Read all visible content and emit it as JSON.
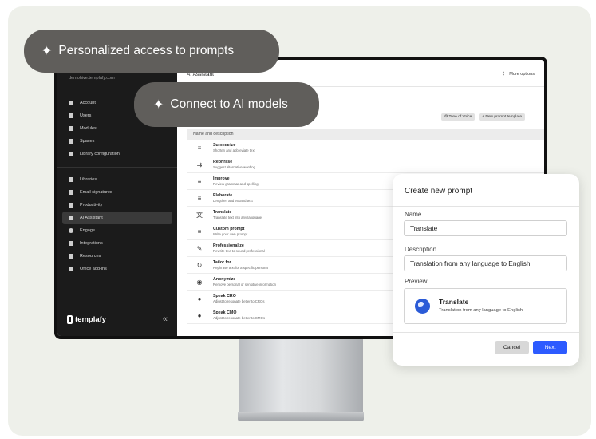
{
  "badges": {
    "personalized": "Personalized access to prompts",
    "connect": "Connect to AI models"
  },
  "sidebar": {
    "domain": "demohive.templafy.com",
    "group1": [
      {
        "label": "Account",
        "icon": "account-icon"
      },
      {
        "label": "Users",
        "icon": "users-icon"
      },
      {
        "label": "Modules",
        "icon": "modules-icon"
      },
      {
        "label": "Spaces",
        "icon": "spaces-icon"
      },
      {
        "label": "Library configuration",
        "icon": "library-config-icon"
      }
    ],
    "group2": [
      {
        "label": "Libraries",
        "icon": "libraries-icon"
      },
      {
        "label": "Email signatures",
        "icon": "email-icon"
      },
      {
        "label": "Productivity",
        "icon": "productivity-icon"
      },
      {
        "label": "AI Assistant",
        "icon": "ai-assistant-icon",
        "active": true
      },
      {
        "label": "Engage",
        "icon": "engage-icon"
      },
      {
        "label": "Integrations",
        "icon": "integrations-icon"
      },
      {
        "label": "Resources",
        "icon": "resources-icon"
      },
      {
        "label": "Office add-ins",
        "icon": "office-icon"
      }
    ],
    "logo": "templafy",
    "collapse_glyph": "«"
  },
  "main": {
    "title": "AI Assistant",
    "more_options": "More options",
    "tone_button": "Tone of Voice",
    "new_prompt_button": "New prompt template",
    "table_header": "Name and description",
    "rows": [
      {
        "title": "Summarize",
        "sub": "Shorten and abbreviate text",
        "icon": "≡"
      },
      {
        "title": "Rephrase",
        "sub": "Suggest alternative wording",
        "icon": "⇉"
      },
      {
        "title": "Improve",
        "sub": "Review grammar and spelling",
        "icon": "≡"
      },
      {
        "title": "Elaborate",
        "sub": "Lengthen and expand text",
        "icon": "≡"
      },
      {
        "title": "Translate",
        "sub": "Translate text into any language",
        "icon": "文"
      },
      {
        "title": "Custom prompt",
        "sub": "Write your own prompt",
        "icon": "≡"
      },
      {
        "title": "Professionalize",
        "sub": "Rewrite text to sound professional",
        "icon": "✎"
      },
      {
        "title": "Tailor for...",
        "sub": "Rephrase text for a specific persona",
        "icon": "↻"
      },
      {
        "title": "Anonymize",
        "sub": "Remove personal or sensitive information",
        "icon": "◉"
      },
      {
        "title": "Speak CRO",
        "sub": "Adjust to resonate better to CROs",
        "icon": "●"
      },
      {
        "title": "Speak CMO",
        "sub": "Adjust to resonate better to CMOs",
        "icon": "●"
      }
    ]
  },
  "dialog": {
    "title": "Create new prompt",
    "name_label": "Name",
    "name_value": "Translate",
    "description_label": "Description",
    "description_value": "Translation from any language to English",
    "preview_label": "Preview",
    "preview_title": "Translate",
    "preview_sub": "Translation from any language to English",
    "cancel": "Cancel",
    "next": "Next"
  }
}
